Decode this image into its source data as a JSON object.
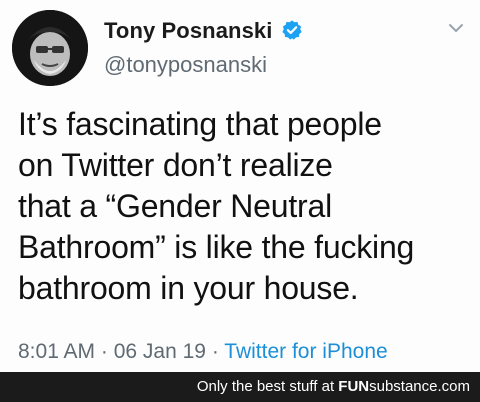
{
  "tweet": {
    "display_name": "Tony Posnanski",
    "handle": "@tonyposnanski",
    "verified_icon": "verified-badge-icon",
    "verified_color": "#1da1f2",
    "text_lines": [
      "It’s fascinating that people",
      "on Twitter don’t realize",
      "that a “Gender Neutral",
      "Bathroom” is like the fucking",
      "bathroom in your house."
    ],
    "time": "8:01 AM",
    "separator": " · ",
    "date": "06 Jan 19",
    "source": "Twitter for iPhone"
  },
  "footer": {
    "prefix": "Only the best stuff at ",
    "brand_fun": "FUN",
    "brand_rest": "substance.com",
    "background": "#1b1b1b"
  }
}
